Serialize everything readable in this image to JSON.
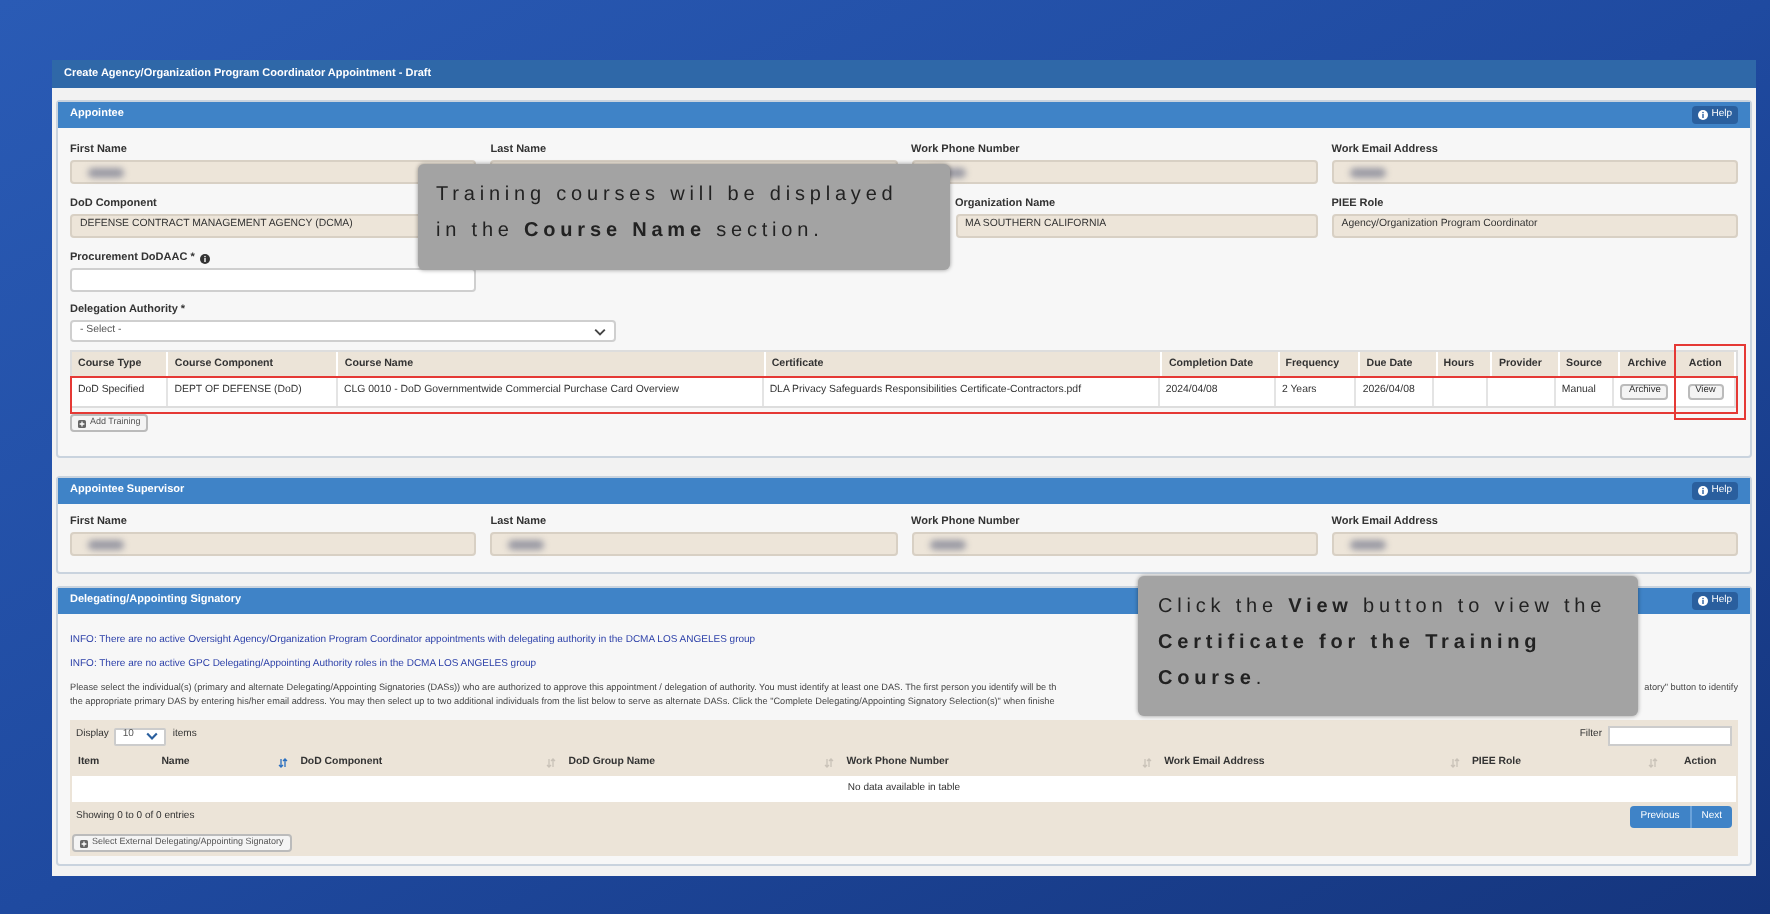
{
  "window": {
    "title": "Create Agency/Organization Program Coordinator Appointment - Draft"
  },
  "appointee": {
    "title": "Appointee",
    "help": "Help",
    "rows": [
      [
        {
          "label": "First Name",
          "redacted": true
        },
        {
          "label": "Last Name"
        },
        {
          "label": "Work Phone Number",
          "redacted": true
        },
        {
          "label": "Work Email Address",
          "redacted": true
        }
      ],
      [
        {
          "label": "DoD Component",
          "value": "DEFENSE CONTRACT MANAGEMENT AGENCY (DCMA)"
        },
        "",
        {
          "label": "Organization Name",
          "value": "MA SOUTHERN CALIFORNIA"
        },
        {
          "label": "PIEE Role",
          "value": "Agency/Organization Program Coordinator"
        }
      ]
    ],
    "dodaac": {
      "label": "Procurement DoDAAC *",
      "info_icon": true
    },
    "delegation": {
      "label": "Delegation Authority *",
      "value": "- Select -"
    },
    "courses": {
      "columns": [
        {
          "label": "Course Type"
        },
        {
          "label": "Course Component"
        },
        {
          "label": "Course Name"
        },
        {
          "label": "Certificate"
        },
        {
          "label": "Completion Date"
        },
        {
          "label": "Frequency"
        },
        {
          "label": "Due Date"
        },
        {
          "label": "Hours"
        },
        {
          "label": "Provider"
        },
        {
          "label": "Source"
        },
        {
          "label": "Archive"
        },
        {
          "label": "Action",
          "highlighted": true
        }
      ],
      "rows": [
        {
          "highlighted": true,
          "course_type": "DoD Specified",
          "course_component": "DEPT OF DEFENSE (DoD)",
          "course_name": "CLG 0010 - DoD Governmentwide Commercial Purchase Card Overview",
          "certificate": "DLA Privacy Safeguards Responsibilities Certificate-Contractors.pdf",
          "completion_date": "2024/04/08",
          "frequency": "2 Years",
          "due_date": "2026/04/08",
          "source": "Manual",
          "archive_button": "Archive",
          "action_button": "View"
        }
      ]
    },
    "add_training": "Add Training"
  },
  "supervisor": {
    "title": "Appointee Supervisor",
    "help": "Help",
    "fields": [
      {
        "label": "First Name",
        "redacted": true
      },
      {
        "label": "Last Name",
        "redacted": true
      },
      {
        "label": "Work Phone Number",
        "redacted": true
      },
      {
        "label": "Work Email Address",
        "redacted": true
      }
    ]
  },
  "signatory": {
    "title": "Delegating/Appointing Signatory",
    "help": "Help",
    "info": [
      "INFO: There are no active Oversight Agency/Organization Program Coordinator appointments with delegating authority in the DCMA LOS ANGELES group",
      "INFO: There are no active GPC Delegating/Appointing Authority roles in the DCMA LOS ANGELES group"
    ],
    "instructions": [
      {
        "left": "Please select the individual(s) (primary and alternate Delegating/Appointing Signatories (DASs)) who are authorized to approve this appointment / delegation of authority. You must identify at least one DAS. The first person you identify will be th",
        "right": "atory\" button to identify"
      },
      {
        "left": "the appropriate primary DAS by entering his/her email address. You may then select up to two additional individuals from the list below to serve as alternate DASs. Click the \"Complete Delegating/Appointing Signatory Selection(s)\" when finishe"
      }
    ],
    "display": {
      "label": "Display",
      "value": "10",
      "suffix": "items"
    },
    "filter": {
      "label": "Filter"
    },
    "columns": [
      {
        "label": "Item",
        "kind": "plain"
      },
      {
        "label": "Name",
        "kind": "sortable",
        "sorted": true
      },
      {
        "label": "DoD Component",
        "kind": "sortable",
        "sorted": false
      },
      {
        "label": "DoD Group Name",
        "kind": "sortable",
        "sorted": false
      },
      {
        "label": "Work Phone Number",
        "kind": "sortable",
        "sorted": false
      },
      {
        "label": "Work Email Address",
        "kind": "sortable",
        "sorted": false
      },
      {
        "label": "PIEE Role",
        "kind": "sortable",
        "sorted": false
      },
      {
        "label": "Action",
        "kind": "plain"
      }
    ],
    "empty": "No data available in table",
    "showing": "Showing 0 to 0 of 0 entries",
    "pagination": [
      "Previous",
      "Next"
    ],
    "select_external": "Select External Delegating/Appointing Signatory"
  },
  "callouts": [
    {
      "text": "Training courses will be displayed in the **Course Name** section."
    },
    {
      "text": "Click the **View** button to view the **Certificate for the Training Course**."
    }
  ]
}
